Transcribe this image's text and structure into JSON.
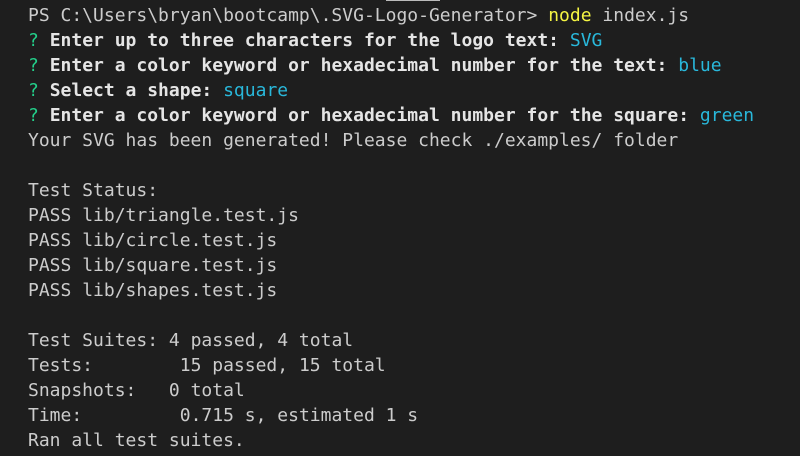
{
  "prompt": {
    "path": "PS C:\\Users\\bryan\\bootcamp\\.SVG-Logo-Generator>",
    "command": "node",
    "args": "index.js"
  },
  "questions": [
    {
      "mark": "?",
      "text": "Enter up to three characters for the logo text:",
      "answer": "SVG"
    },
    {
      "mark": "?",
      "text": "Enter a color keyword or hexadecimal number for the text:",
      "answer": "blue"
    },
    {
      "mark": "?",
      "text": "Select a shape:",
      "answer": "square"
    },
    {
      "mark": "?",
      "text": "Enter a color keyword or hexadecimal number for the square:",
      "answer": "green"
    }
  ],
  "result_message": "Your SVG has been generated! Please check ./examples/ folder",
  "test_status": {
    "heading": "Test Status:",
    "results": [
      {
        "status": "PASS",
        "file": "lib/triangle.test.js"
      },
      {
        "status": "PASS",
        "file": "lib/circle.test.js"
      },
      {
        "status": "PASS",
        "file": "lib/square.test.js"
      },
      {
        "status": "PASS",
        "file": "lib/shapes.test.js"
      }
    ]
  },
  "summary": {
    "suites_label": "Test Suites:",
    "suites_value": "4 passed, 4 total",
    "tests_label": "Tests:",
    "tests_value": "15 passed, 15 total",
    "snapshots_label": "Snapshots:",
    "snapshots_value": "0 total",
    "time_label": "Time:",
    "time_value": "0.715 s, estimated 1 s",
    "footer": "Ran all test suites."
  },
  "colors": {
    "background": "#1e1e1e",
    "text": "#cccccc",
    "question_mark": "#23d18b",
    "answer": "#29b8db",
    "command": "#f5f543"
  }
}
